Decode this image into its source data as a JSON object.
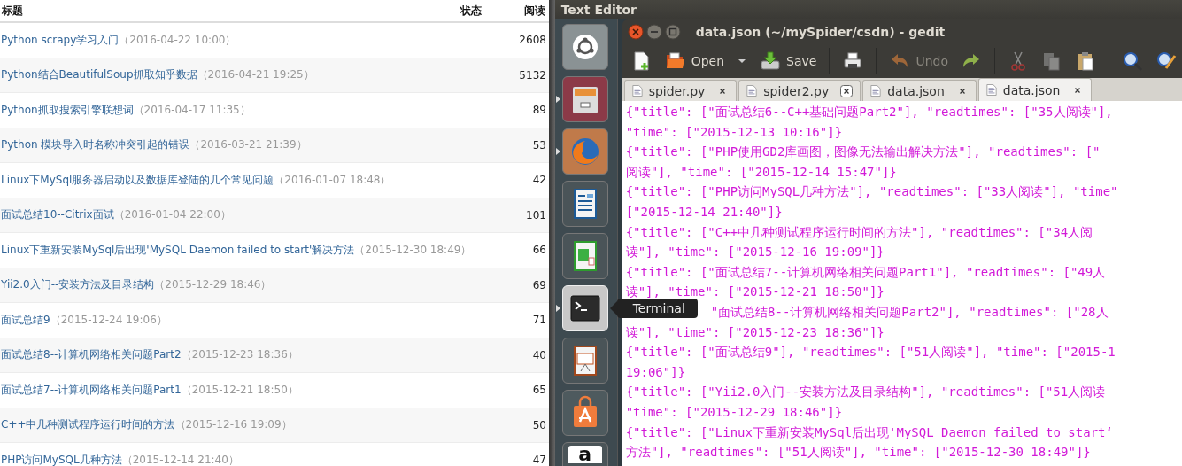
{
  "blog_table": {
    "columns": [
      {
        "label": "标题"
      },
      {
        "label": "状态"
      },
      {
        "label": "阅读"
      }
    ],
    "rows": [
      {
        "title": "Python scrapy学习入门",
        "date": "（2016-04-22 10:00）",
        "reads": "2608"
      },
      {
        "title": "Python结合BeautifulSoup抓取知乎数据",
        "date": "（2016-04-21 19:25）",
        "reads": "5132"
      },
      {
        "title": "Python抓取搜索引擎联想词",
        "date": "（2016-04-17 11:35）",
        "reads": "89"
      },
      {
        "title": "Python 模块导入时名称冲突引起的错误",
        "date": "（2016-03-21 21:39）",
        "reads": "53"
      },
      {
        "title": "Linux下MySql服务器启动以及数据库登陆的几个常见问题",
        "date": "（2016-01-07 18:48）",
        "reads": "42"
      },
      {
        "title": "面试总结10--Citrix面试",
        "date": "（2016-01-04 22:00）",
        "reads": "101"
      },
      {
        "title": "Linux下重新安装MySql后出现'MySQL Daemon failed to start'解决方法",
        "date": "（2015-12-30 18:49）",
        "reads": "66"
      },
      {
        "title": "Yii2.0入门--安装方法及目录结构",
        "date": "（2015-12-29 18:46）",
        "reads": "69"
      },
      {
        "title": "面试总结9",
        "date": "（2015-12-24 19:06）",
        "reads": "71"
      },
      {
        "title": "面试总结8--计算机网络相关问题Part2",
        "date": "（2015-12-23 18:36）",
        "reads": "40"
      },
      {
        "title": "面试总结7--计算机网络相关问题Part1",
        "date": "（2015-12-21 18:50）",
        "reads": "65"
      },
      {
        "title": "C++中几种测试程序运行时间的方法",
        "date": "（2015-12-16 19:09）",
        "reads": "50"
      },
      {
        "title": "PHP访问MySQL几种方法",
        "date": "（2015-12-14 21:40）",
        "reads": "47"
      }
    ]
  },
  "top_panel": {
    "title": "Text Editor"
  },
  "launcher": {
    "items": [
      {
        "kind": "dash",
        "running": false,
        "highlighted": false
      },
      {
        "kind": "files",
        "running": true,
        "highlighted": false
      },
      {
        "kind": "browser",
        "running": true,
        "highlighted": false
      },
      {
        "kind": "writer",
        "running": false,
        "highlighted": false
      },
      {
        "kind": "calc",
        "running": false,
        "highlighted": false
      },
      {
        "kind": "terminal",
        "running": true,
        "highlighted": true,
        "tooltip": "Terminal"
      },
      {
        "kind": "impress",
        "running": false,
        "highlighted": false
      },
      {
        "kind": "software",
        "running": false,
        "highlighted": false
      },
      {
        "kind": "amazon",
        "running": false,
        "highlighted": false,
        "glyph": "a"
      }
    ]
  },
  "editor": {
    "title": "data.json (~/mySpider/csdn) - gedit",
    "toolbar": [
      [
        {
          "kind": "new"
        },
        {
          "kind": "open",
          "label": "Open"
        },
        {
          "kind": "dropdown"
        },
        {
          "kind": "save",
          "label": "Save"
        }
      ],
      [
        {
          "kind": "print"
        }
      ],
      [
        {
          "kind": "undo",
          "label": "Undo",
          "disabled": true
        },
        {
          "kind": "redo",
          "disabled": false
        }
      ],
      [
        {
          "kind": "cut",
          "disabled": true
        },
        {
          "kind": "copy",
          "disabled": true
        },
        {
          "kind": "paste",
          "disabled": false
        }
      ],
      [
        {
          "kind": "find"
        },
        {
          "kind": "replace"
        }
      ]
    ],
    "tabs": [
      {
        "label": "spider.py",
        "selected": false,
        "close_hovered": false
      },
      {
        "label": "spider2.py",
        "selected": false,
        "close_hovered": true
      },
      {
        "label": "data.json",
        "selected": false,
        "close_hovered": false
      },
      {
        "label": "data.json",
        "selected": true,
        "close_hovered": false
      }
    ],
    "lines": [
      {
        "text": "{\"title\": [\"面试总结6--C++基础问题Part2\"], \"readtimes\": [\"35人阅读\"],"
      },
      {
        "text": "\"time\": [\"2015-12-13 10:16\"]}"
      },
      {
        "text": "{\"title\": [\"PHP使用GD2库画图，图像无法输出解决方法\"], \"readtimes\": [\""
      },
      {
        "text": "阅读\"], \"time\": [\"2015-12-14 15:47\"]}"
      },
      {
        "text": "{\"title\": [\"PHP访问MySQL几种方法\"], \"readtimes\": [\"33人阅读\"], \"time\""
      },
      {
        "text": "[\"2015-12-14 21:40\"]}"
      },
      {
        "text": "{\"title\": [\"C++中几种测试程序运行时间的方法\"], \"readtimes\": [\"34人阅"
      },
      {
        "text": "读\"], \"time\": [\"2015-12-16 19:09\"]}"
      },
      {
        "text": "{\"title\": [\"面试总结7--计算机网络相关问题Part1\"], \"readtimes\": [\"49人"
      },
      {
        "text": "读\"], \"time\": [\"2015-12-21 18:50\"]}"
      },
      {
        "text": "\"面试总结8--计算机网络相关问题Part2\"], \"readtimes\": [\"28人",
        "obscured": true
      },
      {
        "text": "读\"], \"time\": [\"2015-12-23 18:36\"]}"
      },
      {
        "text": "{\"title\": [\"面试总结9\"], \"readtimes\": [\"51人阅读\"], \"time\": [\"2015-1"
      },
      {
        "text": "19:06\"]}"
      },
      {
        "text": "{\"title\": [\"Yii2.0入门--安装方法及目录结构\"], \"readtimes\": [\"51人阅读"
      },
      {
        "text": "\"time\": [\"2015-12-29 18:46\"]}"
      },
      {
        "text": "{\"title\": [\"Linux下重新安装MySql后出现'MySQL Daemon failed to start‘"
      },
      {
        "text": "方法\"], \"readtimes\": [\"51人阅读\"], \"time\": [\"2015-12-30 18:49\"]}"
      }
    ]
  }
}
